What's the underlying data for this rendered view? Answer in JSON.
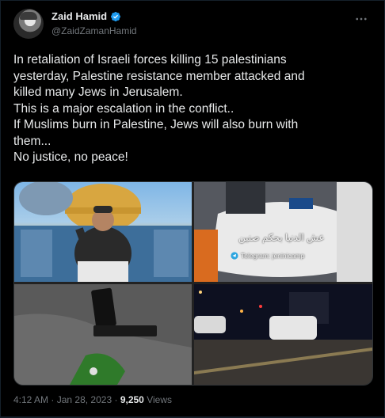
{
  "author": {
    "name": "Zaid Hamid",
    "handle": "@ZaidZamanHamid"
  },
  "tweet": {
    "lines": [
      "In retaliation of Israeli forces killing 15 palestinians",
      "yesterday, Palestine resistance member attacked and",
      "killed many Jews in Jerusalem.",
      "This is a major escalation in the conflict..",
      "If Muslims burn in Palestine, Jews will also burn with",
      "them...",
      "No justice, no peace!"
    ]
  },
  "media": {
    "images": [
      {
        "description_icon": "photo-man-dome"
      },
      {
        "description_icon": "photo-covered-bodies"
      },
      {
        "description_icon": "photo-pistol-ground"
      },
      {
        "description_icon": "photo-night-street-car"
      }
    ],
    "overlay_arabic": "عش الدنيا بحكم صنين",
    "telegram_label": "Telegram: jeninicamp"
  },
  "footer": {
    "time": "4:12 AM",
    "dot1": "·",
    "date": "Jan 28, 2023",
    "dot2": "·",
    "views_count": "9,250",
    "views_label": "Views"
  },
  "colors": {
    "background": "#000000",
    "text": "#e7e9ea",
    "muted": "#71767b",
    "verified": "#1d9bf0"
  }
}
